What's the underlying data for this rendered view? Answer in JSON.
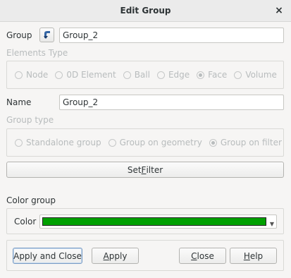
{
  "window": {
    "title": "Edit Group",
    "close_glyph": "×"
  },
  "group": {
    "label": "Group",
    "value": "Group_2",
    "select_icon": "select-arrow-icon"
  },
  "elements_type": {
    "title": "Elements Type",
    "options": [
      "Node",
      "0D Element",
      "Ball",
      "Edge",
      "Face",
      "Volume"
    ],
    "selected": "Face"
  },
  "name": {
    "label": "Name",
    "value": "Group_2"
  },
  "group_type": {
    "title": "Group type",
    "options": [
      "Standalone group",
      "Group on geometry",
      "Group on filter"
    ],
    "selected": "Group on filter"
  },
  "filter": {
    "button_pre": "Set ",
    "button_mnemonic": "F",
    "button_post": "ilter"
  },
  "color_group": {
    "title": "Color group",
    "label": "Color",
    "color": "#00a000"
  },
  "buttons": {
    "apply_close": "Apply and Close",
    "apply_mn": "A",
    "apply_rest": "pply",
    "close_mn": "C",
    "close_rest": "lose",
    "help_mn": "H",
    "help_rest": "elp"
  }
}
